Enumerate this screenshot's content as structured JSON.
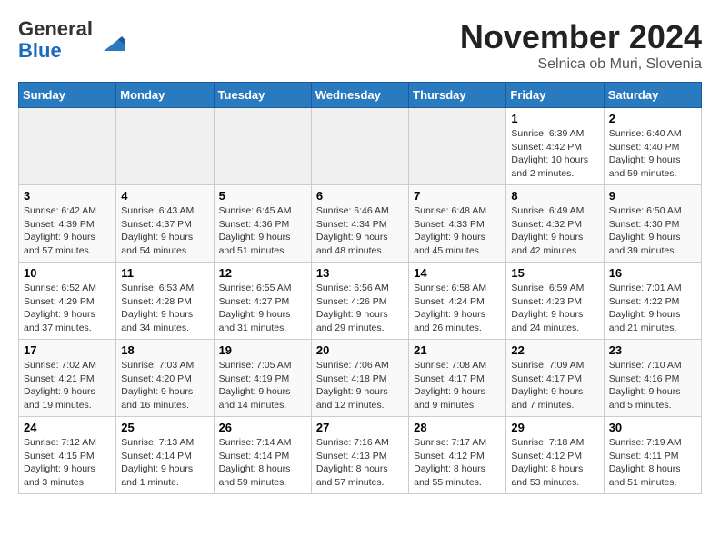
{
  "header": {
    "logo_line1": "General",
    "logo_line2": "Blue",
    "month": "November 2024",
    "location": "Selnica ob Muri, Slovenia"
  },
  "days_of_week": [
    "Sunday",
    "Monday",
    "Tuesday",
    "Wednesday",
    "Thursday",
    "Friday",
    "Saturday"
  ],
  "weeks": [
    [
      {
        "day": "",
        "info": ""
      },
      {
        "day": "",
        "info": ""
      },
      {
        "day": "",
        "info": ""
      },
      {
        "day": "",
        "info": ""
      },
      {
        "day": "",
        "info": ""
      },
      {
        "day": "1",
        "info": "Sunrise: 6:39 AM\nSunset: 4:42 PM\nDaylight: 10 hours\nand 2 minutes."
      },
      {
        "day": "2",
        "info": "Sunrise: 6:40 AM\nSunset: 4:40 PM\nDaylight: 9 hours\nand 59 minutes."
      }
    ],
    [
      {
        "day": "3",
        "info": "Sunrise: 6:42 AM\nSunset: 4:39 PM\nDaylight: 9 hours\nand 57 minutes."
      },
      {
        "day": "4",
        "info": "Sunrise: 6:43 AM\nSunset: 4:37 PM\nDaylight: 9 hours\nand 54 minutes."
      },
      {
        "day": "5",
        "info": "Sunrise: 6:45 AM\nSunset: 4:36 PM\nDaylight: 9 hours\nand 51 minutes."
      },
      {
        "day": "6",
        "info": "Sunrise: 6:46 AM\nSunset: 4:34 PM\nDaylight: 9 hours\nand 48 minutes."
      },
      {
        "day": "7",
        "info": "Sunrise: 6:48 AM\nSunset: 4:33 PM\nDaylight: 9 hours\nand 45 minutes."
      },
      {
        "day": "8",
        "info": "Sunrise: 6:49 AM\nSunset: 4:32 PM\nDaylight: 9 hours\nand 42 minutes."
      },
      {
        "day": "9",
        "info": "Sunrise: 6:50 AM\nSunset: 4:30 PM\nDaylight: 9 hours\nand 39 minutes."
      }
    ],
    [
      {
        "day": "10",
        "info": "Sunrise: 6:52 AM\nSunset: 4:29 PM\nDaylight: 9 hours\nand 37 minutes."
      },
      {
        "day": "11",
        "info": "Sunrise: 6:53 AM\nSunset: 4:28 PM\nDaylight: 9 hours\nand 34 minutes."
      },
      {
        "day": "12",
        "info": "Sunrise: 6:55 AM\nSunset: 4:27 PM\nDaylight: 9 hours\nand 31 minutes."
      },
      {
        "day": "13",
        "info": "Sunrise: 6:56 AM\nSunset: 4:26 PM\nDaylight: 9 hours\nand 29 minutes."
      },
      {
        "day": "14",
        "info": "Sunrise: 6:58 AM\nSunset: 4:24 PM\nDaylight: 9 hours\nand 26 minutes."
      },
      {
        "day": "15",
        "info": "Sunrise: 6:59 AM\nSunset: 4:23 PM\nDaylight: 9 hours\nand 24 minutes."
      },
      {
        "day": "16",
        "info": "Sunrise: 7:01 AM\nSunset: 4:22 PM\nDaylight: 9 hours\nand 21 minutes."
      }
    ],
    [
      {
        "day": "17",
        "info": "Sunrise: 7:02 AM\nSunset: 4:21 PM\nDaylight: 9 hours\nand 19 minutes."
      },
      {
        "day": "18",
        "info": "Sunrise: 7:03 AM\nSunset: 4:20 PM\nDaylight: 9 hours\nand 16 minutes."
      },
      {
        "day": "19",
        "info": "Sunrise: 7:05 AM\nSunset: 4:19 PM\nDaylight: 9 hours\nand 14 minutes."
      },
      {
        "day": "20",
        "info": "Sunrise: 7:06 AM\nSunset: 4:18 PM\nDaylight: 9 hours\nand 12 minutes."
      },
      {
        "day": "21",
        "info": "Sunrise: 7:08 AM\nSunset: 4:17 PM\nDaylight: 9 hours\nand 9 minutes."
      },
      {
        "day": "22",
        "info": "Sunrise: 7:09 AM\nSunset: 4:17 PM\nDaylight: 9 hours\nand 7 minutes."
      },
      {
        "day": "23",
        "info": "Sunrise: 7:10 AM\nSunset: 4:16 PM\nDaylight: 9 hours\nand 5 minutes."
      }
    ],
    [
      {
        "day": "24",
        "info": "Sunrise: 7:12 AM\nSunset: 4:15 PM\nDaylight: 9 hours\nand 3 minutes."
      },
      {
        "day": "25",
        "info": "Sunrise: 7:13 AM\nSunset: 4:14 PM\nDaylight: 9 hours\nand 1 minute."
      },
      {
        "day": "26",
        "info": "Sunrise: 7:14 AM\nSunset: 4:14 PM\nDaylight: 8 hours\nand 59 minutes."
      },
      {
        "day": "27",
        "info": "Sunrise: 7:16 AM\nSunset: 4:13 PM\nDaylight: 8 hours\nand 57 minutes."
      },
      {
        "day": "28",
        "info": "Sunrise: 7:17 AM\nSunset: 4:12 PM\nDaylight: 8 hours\nand 55 minutes."
      },
      {
        "day": "29",
        "info": "Sunrise: 7:18 AM\nSunset: 4:12 PM\nDaylight: 8 hours\nand 53 minutes."
      },
      {
        "day": "30",
        "info": "Sunrise: 7:19 AM\nSunset: 4:11 PM\nDaylight: 8 hours\nand 51 minutes."
      }
    ]
  ]
}
